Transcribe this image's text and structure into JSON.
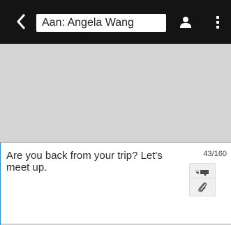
{
  "header": {
    "back_icon": "chevron-left-icon",
    "recipient": "Aan: Angela Wang",
    "contact_icon": "person-icon",
    "menu_icon": "vertical-dots-icon"
  },
  "compose": {
    "message": "Are you back from your trip? Let's meet up.",
    "char_count": "43/160",
    "send_icon": "send-message-icon",
    "attach_icon": "paperclip-icon"
  },
  "colors": {
    "topbar": "#141414",
    "thread_background": "#d4d4d4",
    "focus_accent": "#2a8fd8"
  }
}
